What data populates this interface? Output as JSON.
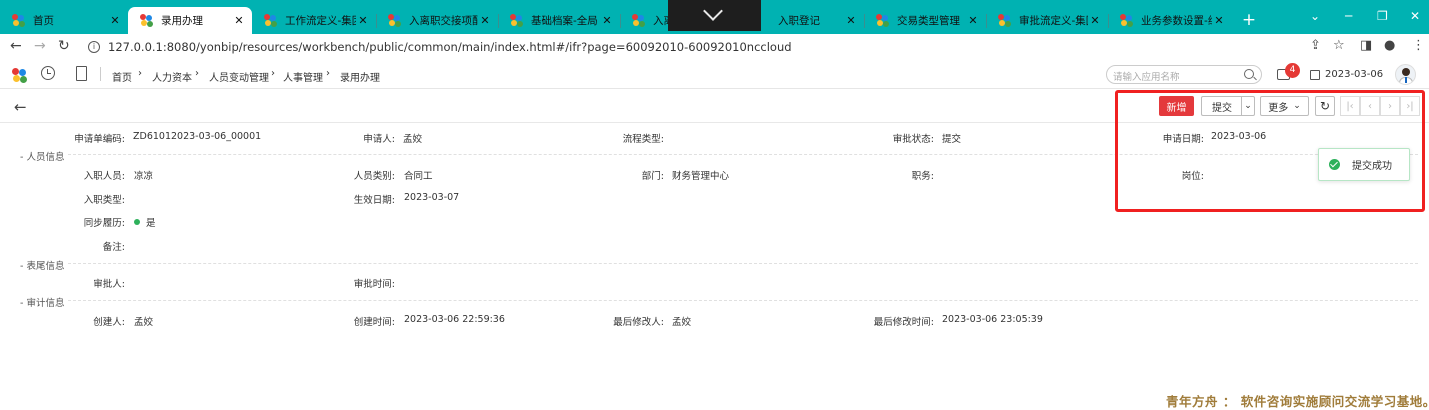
{
  "browser": {
    "tabs": [
      {
        "title": "首页",
        "active": false
      },
      {
        "title": "录用办理",
        "active": true
      },
      {
        "title": "工作流定义-集团",
        "active": false
      },
      {
        "title": "入离职交接项配置",
        "active": false
      },
      {
        "title": "基础档案-全局",
        "active": false
      },
      {
        "title": "入离",
        "active": false
      },
      {
        "title": "入职登记",
        "active": false
      },
      {
        "title": "交易类型管理",
        "active": false
      },
      {
        "title": "审批流定义-集团",
        "active": false
      },
      {
        "title": "业务参数设置-组织",
        "active": false
      }
    ],
    "tab_close_glyph": "✕",
    "new_tab_glyph": "+",
    "url": "127.0.0.1:8080/yonbip/resources/workbench/public/common/main/index.html#/ifr?page=60092010-60092010nccloud"
  },
  "app_header": {
    "breadcrumbs": [
      "首页",
      "人力资本",
      "人员变动管理",
      "人事管理",
      "录用办理"
    ],
    "search_placeholder": "请输入应用名称",
    "notification_count": "4",
    "date": "2023-03-06"
  },
  "toolbar": {
    "add_label": "新增",
    "submit_label": "提交",
    "more_label": "更多",
    "pager": [
      "|‹",
      "‹",
      "›",
      "›|"
    ]
  },
  "header_fields": {
    "app_no_label": "申请单编码:",
    "app_no_value": "ZD61012023-03-06_00001",
    "applicant_label": "申请人:",
    "applicant_value": "孟姣",
    "process_type_label": "流程类型:",
    "process_type_value": "",
    "approve_status_label": "审批状态:",
    "approve_status_value": "提交",
    "apply_date_label": "申请日期:",
    "apply_date_value": "2023-03-06"
  },
  "sections": {
    "person": "- 人员信息",
    "tail": "- 表尾信息",
    "audit": "- 审计信息"
  },
  "person_fields": {
    "entrant_label": "入职人员:",
    "entrant_value": "凉凉",
    "person_type_label": "人员类别:",
    "person_type_value": "合同工",
    "dept_label": "部门:",
    "dept_value": "财务管理中心",
    "job_label": "职务:",
    "job_value": "",
    "post_label": "岗位:",
    "post_value": "",
    "entry_type_label": "入职类型:",
    "entry_type_value": "",
    "effective_date_label": "生效日期:",
    "effective_date_value": "2023-03-07",
    "sync_resume_label": "同步履历:",
    "sync_resume_value": "是",
    "remark_label": "备注:",
    "remark_value": ""
  },
  "tail_fields": {
    "approver_label": "审批人:",
    "approver_value": "",
    "approve_time_label": "审批时间:",
    "approve_time_value": ""
  },
  "audit_fields": {
    "creator_label": "创建人:",
    "creator_value": "孟姣",
    "create_time_label": "创建时间:",
    "create_time_value": "2023-03-06 22:59:36",
    "modifier_label": "最后修改人:",
    "modifier_value": "孟姣",
    "modify_time_label": "最后修改时间:",
    "modify_time_value": "2023-03-06 23:05:39"
  },
  "toast": {
    "text": "提交成功"
  },
  "watermark": "青年方舟 ： 软件咨询实施顾问交流学习基地。",
  "colors": {
    "tabbar": "#00b2b2",
    "primary_button": "#e4393c",
    "highlight_box": "#f02020",
    "success": "#2db15b"
  }
}
